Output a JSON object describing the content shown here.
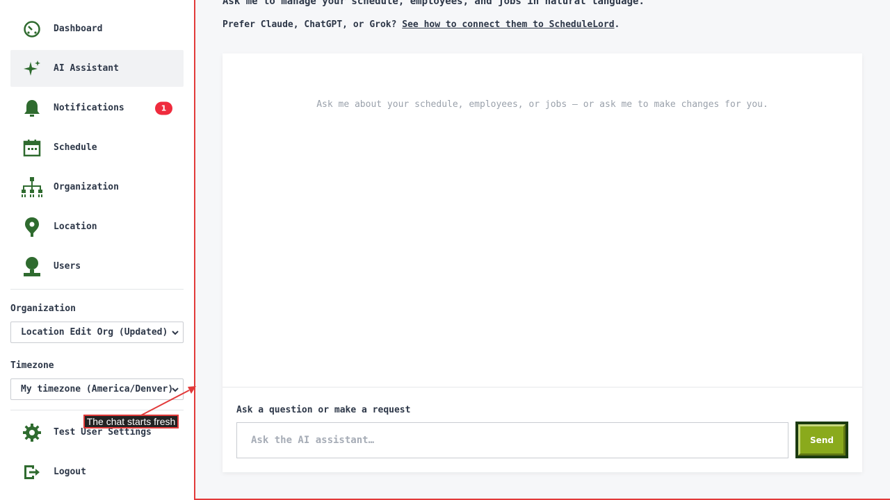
{
  "sidebar": {
    "items": [
      {
        "label": "Dashboard",
        "icon": "dashboard-gauge-icon",
        "active": false
      },
      {
        "label": "AI Assistant",
        "icon": "sparkle-icon",
        "active": true
      },
      {
        "label": "Notifications",
        "icon": "bell-icon",
        "active": false,
        "badge": "1"
      },
      {
        "label": "Schedule",
        "icon": "calendar-icon",
        "active": false
      },
      {
        "label": "Organization",
        "icon": "org-chart-icon",
        "active": false
      },
      {
        "label": "Location",
        "icon": "map-pin-icon",
        "active": false
      },
      {
        "label": "Users",
        "icon": "user-icon",
        "active": false
      }
    ],
    "organization": {
      "label": "Organization",
      "value": "Location Edit Org (Updated)"
    },
    "timezone": {
      "label": "Timezone",
      "value": "My timezone (America/Denver)"
    },
    "bottom_items": [
      {
        "label": "Test User Settings",
        "icon": "gear-icon"
      },
      {
        "label": "Logout",
        "icon": "logout-icon"
      }
    ]
  },
  "main": {
    "intro": "Ask me to manage your schedule, employees, and jobs in natural language.",
    "prefer_prefix": "Prefer Claude, ChatGPT, or Grok? ",
    "prefer_link": "See how to connect them to ScheduleLord",
    "prefer_suffix": ".",
    "empty_message": "Ask me about your schedule, employees, or jobs — or ask me to make changes for you.",
    "composer": {
      "label": "Ask a question or make a request",
      "placeholder": "Ask the AI assistant…",
      "send_label": "Send"
    }
  },
  "annotation": {
    "text": "The chat starts fresh"
  },
  "colors": {
    "icon_green": "#2f6b2f",
    "accent_green": "#8aaa1c",
    "badge_red": "#ef2b3d",
    "frame_red": "#e23a3a"
  }
}
